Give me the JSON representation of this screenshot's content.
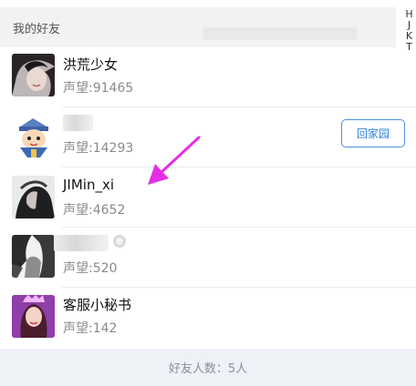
{
  "header": {
    "title": "我的好友"
  },
  "index_letters": [
    "H",
    "J",
    "K",
    "T"
  ],
  "friends": [
    {
      "name": "洪荒少女",
      "reputation": "声望:91465"
    },
    {
      "name": "",
      "reputation": "声望:14293",
      "action_label": "回家园"
    },
    {
      "name": "JIMin_xi",
      "reputation": "声望:4652"
    },
    {
      "name": "",
      "reputation": "声望:520"
    },
    {
      "name": "客服小秘书",
      "reputation": "声望:142"
    }
  ],
  "footer": {
    "count_text": "好友人数：5人"
  },
  "colors": {
    "accent": "#2f7fd8",
    "annotation_arrow": "#e62ee6"
  }
}
